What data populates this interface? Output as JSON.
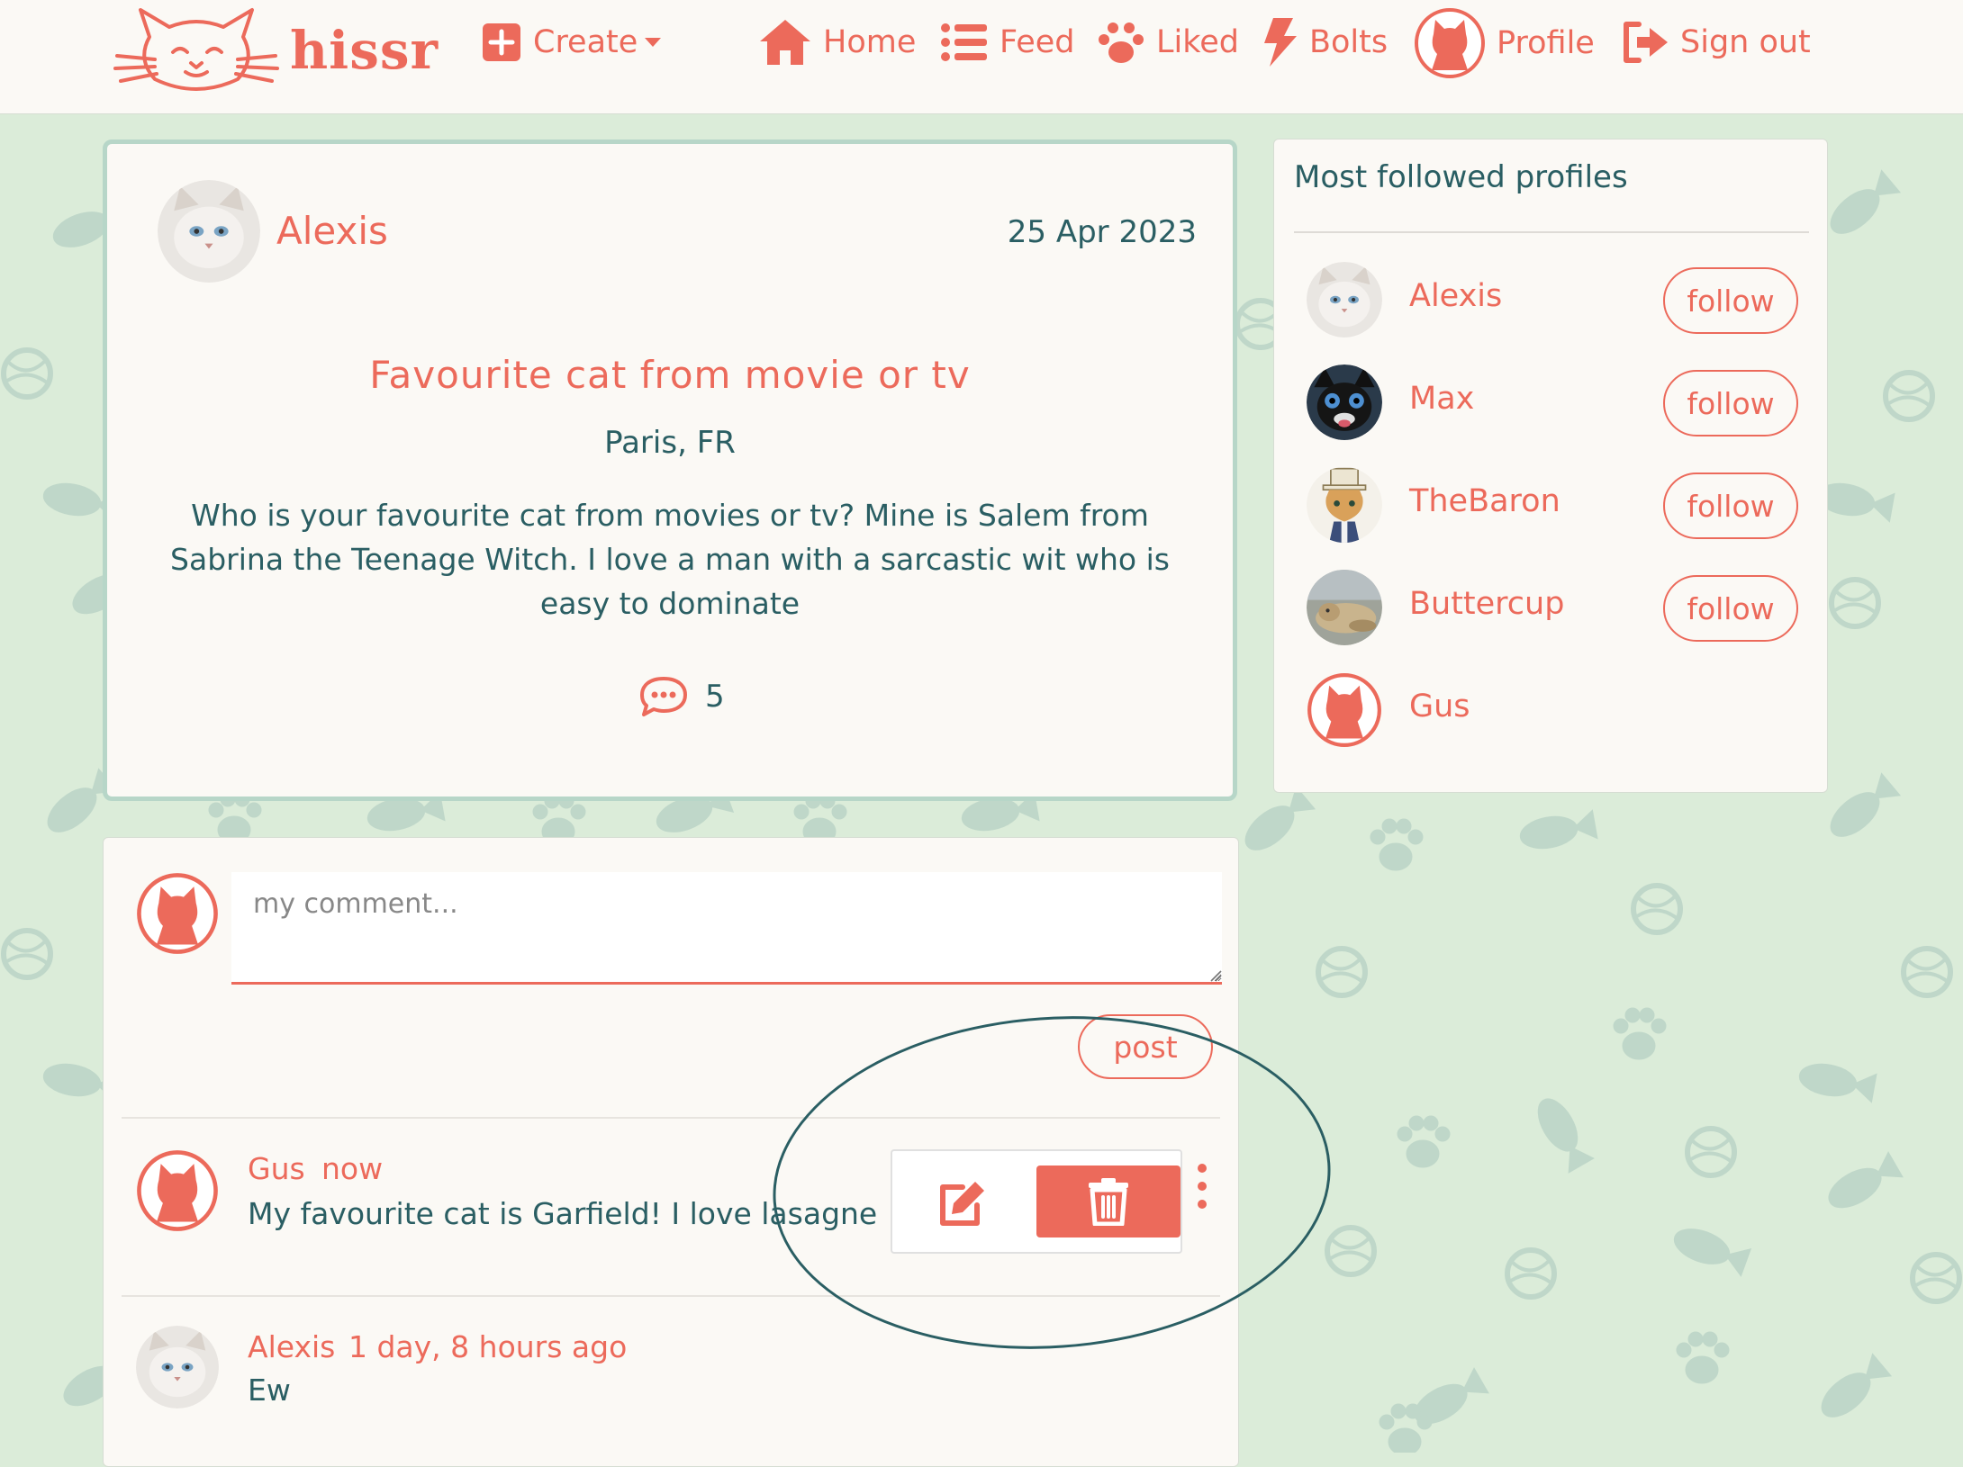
{
  "app": {
    "brand": "hissr"
  },
  "nav": {
    "create": "Create",
    "home": "Home",
    "feed": "Feed",
    "liked": "Liked",
    "bolts": "Bolts",
    "profile": "Profile",
    "sign_out": "Sign out"
  },
  "post": {
    "owner": "Alexis",
    "date": "25 Apr 2023",
    "title": "Favourite cat from movie or tv",
    "location": "Paris, FR",
    "body": "Who is your favourite cat from movies or tv? Mine is Salem from Sabrina the Teenage Witch. I love a man with a sarcastic wit who is easy to dominate",
    "comments_count": "5"
  },
  "sidebar": {
    "title": "Most followed profiles",
    "follow_label": "follow",
    "profiles": [
      {
        "name": "Alexis",
        "avatar": "white-cat"
      },
      {
        "name": "Max",
        "avatar": "black-dog"
      },
      {
        "name": "TheBaron",
        "avatar": "cat-in-top-hat"
      },
      {
        "name": "Buttercup",
        "avatar": "lion-cub"
      },
      {
        "name": "Gus",
        "avatar": "default-cat"
      }
    ]
  },
  "comment_form": {
    "placeholder": "my comment...",
    "submit_label": "post"
  },
  "comments": [
    {
      "author": "Gus",
      "time": "now",
      "text": "My favourite cat is Garfield! I love lasagne",
      "avatar": "default-cat"
    },
    {
      "author": "Alexis",
      "time": "1 day, 8 hours ago",
      "text": "Ew",
      "avatar": "white-cat"
    }
  ],
  "colors": {
    "accent": "#ec6a5b",
    "text": "#2a5e63",
    "background": "#dbecd9",
    "card": "#fbf9f5",
    "card_border": "#b7d6c8"
  },
  "icons": {
    "create": "plus-square-icon",
    "home": "house-icon",
    "feed": "list-icon",
    "liked": "paw-icon",
    "bolts": "bolt-icon",
    "profile": "cat-avatar-icon",
    "sign_out": "sign-out-icon",
    "comments": "speech-bubble-icon",
    "edit": "edit-icon",
    "delete": "trash-icon",
    "more": "kebab-icon"
  }
}
